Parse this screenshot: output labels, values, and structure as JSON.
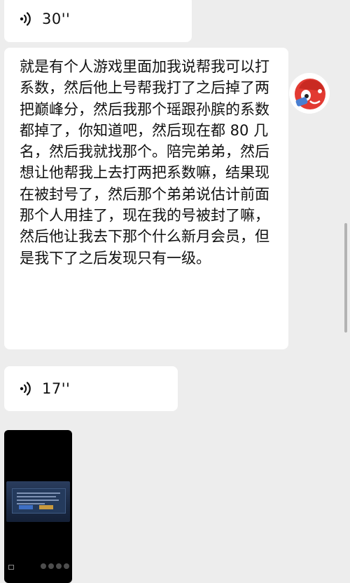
{
  "messages": {
    "voice_top": {
      "duration": "30''"
    },
    "text": {
      "content": "就是有个人游戏里面加我说帮我可以打系数，然后他上号帮我打了之后掉了两把巅峰分，然后我那个瑶跟孙膑的系数都掉了，你知道吧，然后现在都 80 几名，然后我就找那个。陪完弟弟，然后想让他帮我上去打两把系数嘛，结果现在被封号了，然后那个弟弟说估计前面那个人用挂了，现在我的号被封了嘛，然后他让我去下那个什么新月会员，但是我下了之后发现只有一级。"
    },
    "voice_mid": {
      "duration": "17''"
    }
  },
  "icons": {
    "voice": "voice-wave-icon",
    "avatar": "cartoon-avatar"
  },
  "colors": {
    "background": "#ededed",
    "bubble": "#ffffff",
    "text": "#111111"
  }
}
